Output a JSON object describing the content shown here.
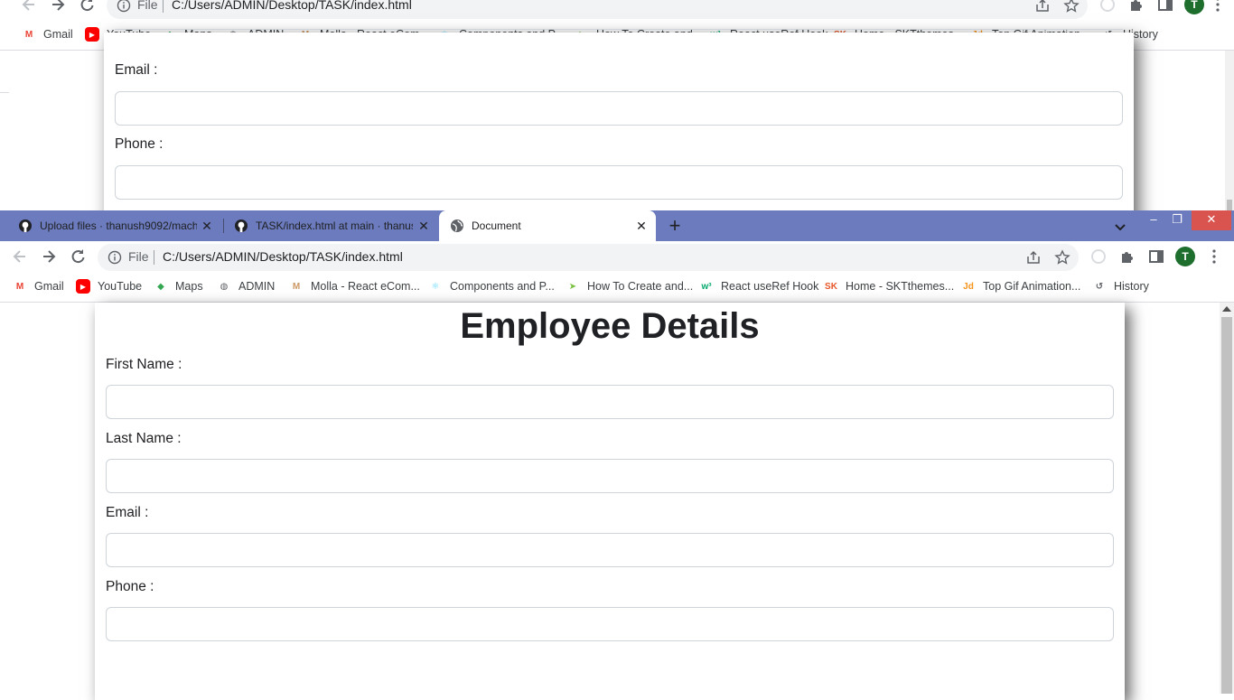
{
  "back_window": {
    "address": {
      "scheme": "File",
      "url": "C:/Users/ADMIN/Desktop/TASK/index.html"
    },
    "fields": [
      {
        "label": "Email :"
      },
      {
        "label": "Phone :"
      }
    ],
    "avatar_initial": "T"
  },
  "front_window": {
    "tabs": [
      {
        "title": "Upload files · thanush9092/mach",
        "icon": "github-icon",
        "active": false
      },
      {
        "title": "TASK/index.html at main · thanus",
        "icon": "github-icon",
        "active": false
      },
      {
        "title": "Document",
        "icon": "globe-icon",
        "active": true
      }
    ],
    "new_tab": "+",
    "window_controls": {
      "minimize": "–",
      "restore": "❐",
      "close": "✕"
    },
    "address": {
      "scheme": "File",
      "url": "C:/Users/ADMIN/Desktop/TASK/index.html"
    },
    "avatar_initial": "T",
    "page": {
      "heading": "Employee Details",
      "fields": [
        {
          "label": "First Name :",
          "value": ""
        },
        {
          "label": "Last Name :",
          "value": ""
        },
        {
          "label": "Email :",
          "value": ""
        },
        {
          "label": "Phone :",
          "value": ""
        }
      ]
    }
  },
  "bookmarks": [
    {
      "label": "Gmail",
      "icon": "gmail-icon",
      "color": "#ea4335"
    },
    {
      "label": "YouTube",
      "icon": "youtube-icon",
      "color": "#ff0000"
    },
    {
      "label": "Maps",
      "icon": "maps-icon",
      "color": "#34a853"
    },
    {
      "label": "ADMIN",
      "icon": "globe-icon",
      "color": "#5f6368"
    },
    {
      "label": "Molla - React eCom...",
      "icon": "molla-icon",
      "color": "#c96"
    },
    {
      "label": "Components and P...",
      "icon": "react-icon",
      "color": "#61dafb"
    },
    {
      "label": "How To Create and...",
      "icon": "arrow-logo-icon",
      "color": "#7cc242"
    },
    {
      "label": "React useRef Hook",
      "icon": "w3-icon",
      "color": "#04aa6d"
    },
    {
      "label": "Home - SKTthemes...",
      "icon": "skt-icon",
      "color": "#e8562a"
    },
    {
      "label": "Top Gif Animation...",
      "icon": "jd-icon",
      "color": "#f7941d"
    },
    {
      "label": "History",
      "icon": "history-icon",
      "color": "#5f6368"
    }
  ]
}
